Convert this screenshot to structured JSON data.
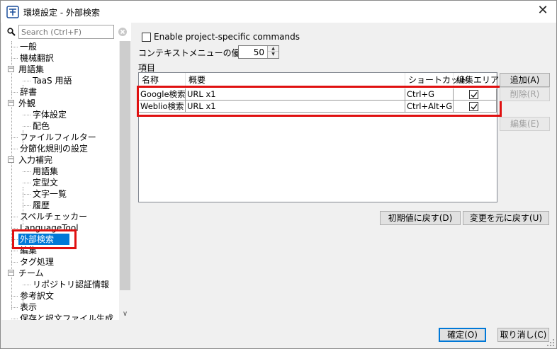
{
  "window": {
    "title": "環境設定 - 外部検索",
    "close_glyph": "✕"
  },
  "search": {
    "placeholder": "Search (Ctrl+F)"
  },
  "tree": [
    {
      "label": "一般"
    },
    {
      "label": "機械翻訳"
    },
    {
      "label": "用語集"
    },
    {
      "label": "TaaS 用語"
    },
    {
      "label": "辞書"
    },
    {
      "label": "外観"
    },
    {
      "label": "字体設定"
    },
    {
      "label": "配色"
    },
    {
      "label": "ファイルフィルター"
    },
    {
      "label": "分節化規則の設定"
    },
    {
      "label": "入力補完"
    },
    {
      "label": "用語集"
    },
    {
      "label": "定型文"
    },
    {
      "label": "文字一覧"
    },
    {
      "label": "履歴"
    },
    {
      "label": "スペルチェッカー"
    },
    {
      "label": "LanguageTool"
    },
    {
      "label": "外部検索"
    },
    {
      "label": "編集"
    },
    {
      "label": "タグ処理"
    },
    {
      "label": "チーム"
    },
    {
      "label": "リポジトリ認証情報"
    },
    {
      "label": "参考訳文"
    },
    {
      "label": "表示"
    },
    {
      "label": "保存と訳文ファイル生成"
    }
  ],
  "main": {
    "project_specific_label": "Enable project-specific commands",
    "priority_label": "コンテキストメニューの優先度:",
    "priority_value": "50",
    "items_label": "項目",
    "columns": [
      "名称",
      "概要",
      "ショートカット",
      "編集エリア"
    ],
    "rows": [
      {
        "name": "Google検索",
        "summary": "URL x1",
        "shortcut": "Ctrl+G",
        "edit_area": true
      },
      {
        "name": "Weblio検索",
        "summary": "URL x1",
        "shortcut": "Ctrl+Alt+G",
        "edit_area": true
      }
    ],
    "buttons": {
      "add": "追加(A)",
      "delete": "削除(R)",
      "edit": "編集(E)",
      "reset_initial": "初期値に戻す(D)",
      "revert": "変更を元に戻す(U)"
    }
  },
  "footer": {
    "ok": "確定(O)",
    "cancel": "取り消し(C)"
  },
  "colors": {
    "selection": "#0078d7",
    "highlight": "#e01010"
  }
}
